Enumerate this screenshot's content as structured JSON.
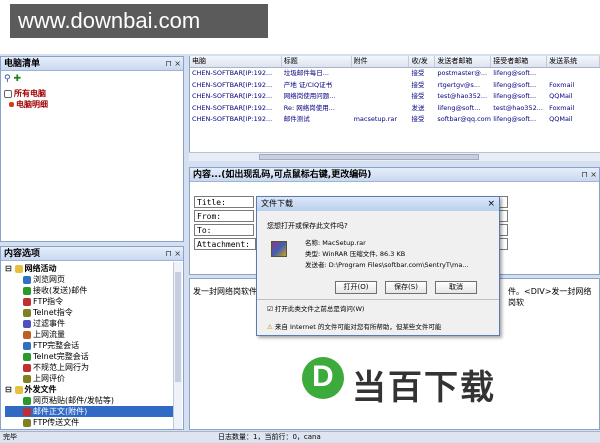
{
  "watermark_top": "www.downbai.com",
  "left_panel": {
    "title": "电脑清单",
    "pin": "⊓ ×",
    "items": [
      {
        "label": "所有电脑"
      },
      {
        "label": "电脑明细"
      }
    ]
  },
  "grid": {
    "columns": [
      "电脑",
      "标题",
      "附件",
      "收/发",
      "发送者邮箱",
      "接受者邮箱",
      "发送系统"
    ],
    "rows": [
      [
        "CHEN-SOFTBAR[IP:192...",
        "垃圾邮件每日...",
        "",
        "接受",
        "postmaster@...",
        "lifeng@soft...",
        ""
      ],
      [
        "CHEN-SOFTBAR[IP:192...",
        "产地 证/CIQ证书",
        "",
        "接受",
        "rtgertgv@s...",
        "lifeng@soft...",
        "Foxmail"
      ],
      [
        "CHEN-SOFTBAR[IP:192...",
        "网络岗使用问题...",
        "",
        "接受",
        "test@hao352...",
        "lifeng@soft...",
        "QQMail"
      ],
      [
        "CHEN-SOFTBAR[IP:192...",
        "Re: 网络岗使用...",
        "",
        "发送",
        "lifeng@soft...",
        "test@hao352...",
        "Foxmail"
      ],
      [
        "CHEN-SOFTBAR[IP:192...",
        "邮件测试",
        "macsetup.rar",
        "接受",
        "softbar@qq.com",
        "lifeng@soft...",
        "QQMail"
      ]
    ]
  },
  "content_panel": {
    "title": "内容...(如出现乱码,可点鼠标右键,更改编码)",
    "pin": "⊓ ×",
    "fields": [
      "Title:",
      "From:",
      "To:",
      "Attachment:"
    ],
    "body_text": "发一封网络岗软件",
    "body_text_right": "件。<DIV>发一封网络岗软"
  },
  "options_panel": {
    "title": "内容选项",
    "pin": "⊓ ×",
    "groups": [
      {
        "label": "网络活动",
        "items": [
          "浏览网页",
          "接收(发送)邮件",
          "FTP指令",
          "Telnet指令",
          "过滤事件",
          "上网流量",
          "FTP完整会话",
          "Telnet完整会话",
          "不规范上网行为",
          "上网评价"
        ]
      },
      {
        "label": "外发文件",
        "items": [
          "网页粘贴(邮件/发帖等)",
          "邮件正文(附件)",
          "FTP传送文件",
          "MSN传送文件"
        ]
      }
    ]
  },
  "dialog": {
    "title": "文件下载",
    "close": "×",
    "question": "您想打开或保存此文件吗?",
    "name_label": "名称:",
    "name_value": "MacSetup.rar",
    "type_label": "类型:",
    "type_value": "WinRAR 压缩文件, 86.3 KB",
    "from_label": "发送者:",
    "from_value": "D:\\Program Files\\softbar.com\\SentryT\\ma...",
    "open_btn": "打开(O)",
    "save_btn": "保存(S)",
    "cancel_btn": "取消",
    "checkbox_label": "打开此类文件之前总是询问(W)",
    "warning": "来自 Internet 的文件可能对您有所帮助，但某些文件可能"
  },
  "status_bar": {
    "left": "完毕",
    "right": "日志数量：1，当前行：0，cana"
  },
  "brand": {
    "letter": "D",
    "text": "当百下载"
  }
}
